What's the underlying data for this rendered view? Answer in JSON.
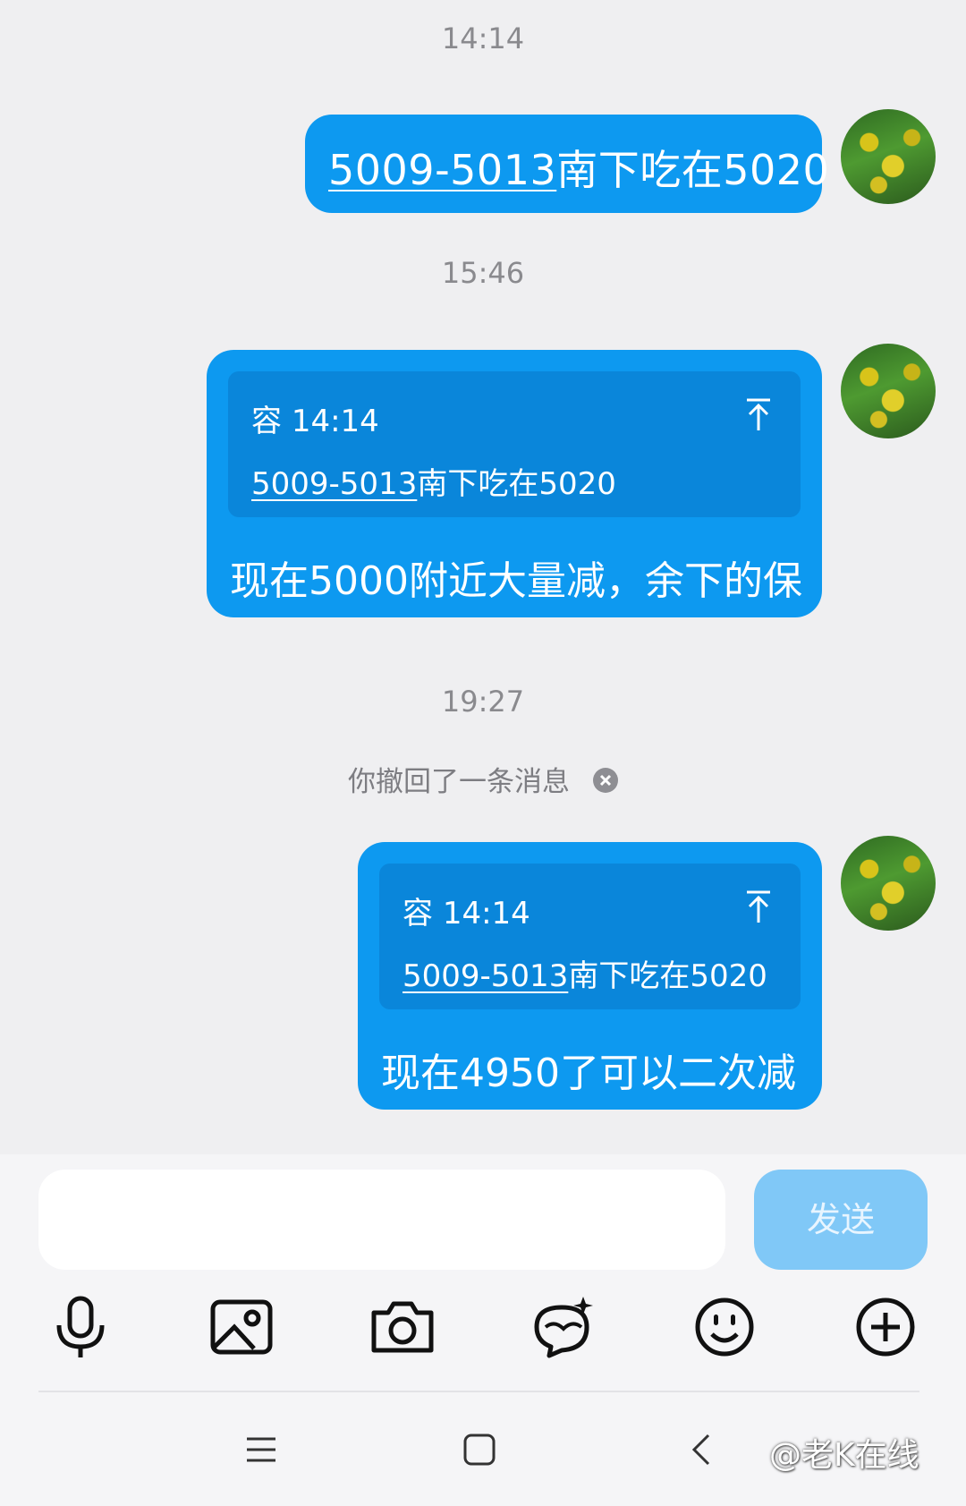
{
  "timestamps": [
    "14:14",
    "15:46",
    "19:27"
  ],
  "messages": [
    {
      "link_text": "5009-5013",
      "rest_text": "南下吃在5020"
    },
    {
      "quote_author": "容",
      "quote_time": "14:14",
      "quote_link": "5009-5013",
      "quote_rest": "南下吃在5020",
      "text": "现在5000附近大量减，余下的保"
    },
    {
      "quote_author": "容",
      "quote_time": "14:14",
      "quote_link": "5009-5013",
      "quote_rest": "南下吃在5020",
      "text": "现在4950了可以二次减"
    }
  ],
  "recall_notice": "你撤回了一条消息",
  "input": {
    "value": "",
    "send_label": "发送"
  },
  "toolbar_icons": [
    "microphone-icon",
    "image-icon",
    "camera-icon",
    "sticker-icon",
    "emoji-icon",
    "plus-icon"
  ],
  "watermark": "@老K在线",
  "colors": {
    "bubble": "#0d99f0",
    "quote": "#0a86da",
    "send_disabled": "#80c8f7"
  }
}
